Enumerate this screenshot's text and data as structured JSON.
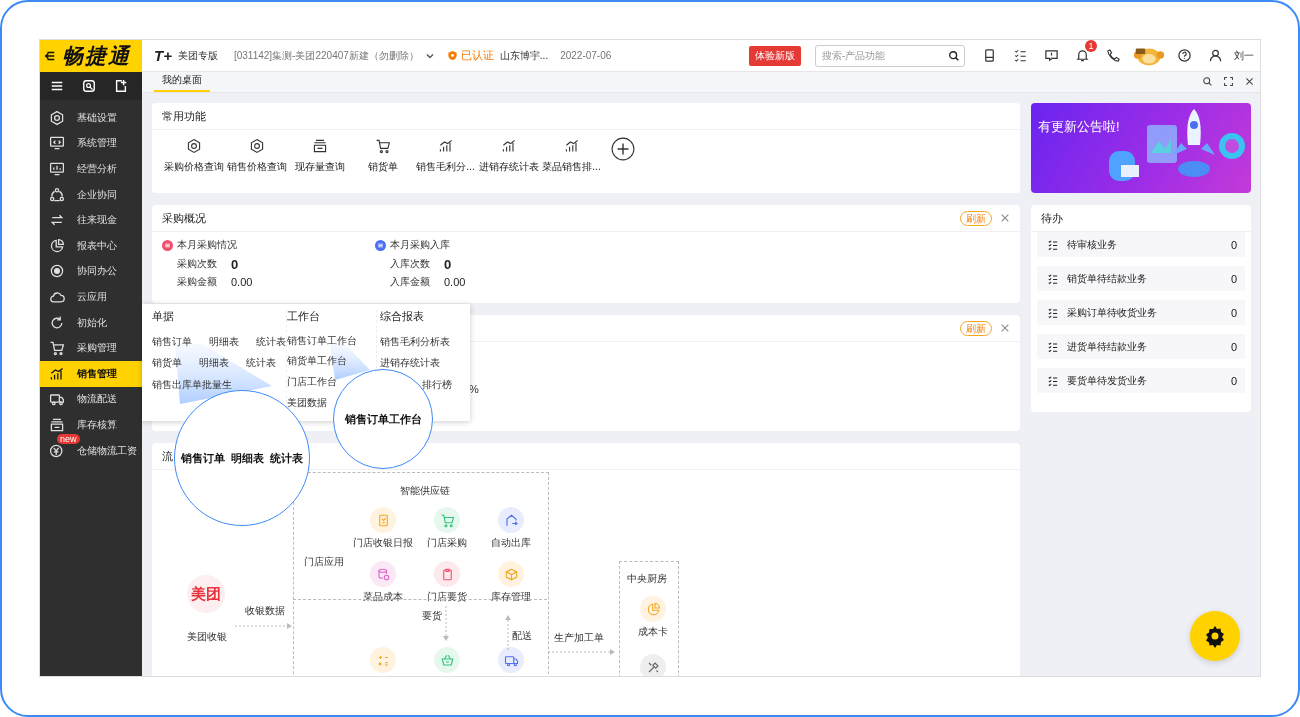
{
  "logo": {
    "text": "畅捷通"
  },
  "header": {
    "brand": "T+",
    "edition": "美团专版",
    "account": "[031142]集测-美团220407新建（勿删除）",
    "verified": "已认证",
    "company": "山东博宇...",
    "date": "2022-07-06",
    "try_new": "体验新版",
    "search": {
      "placeholder": "搜索-产品功能"
    },
    "notification_count": "1",
    "user": "刘一"
  },
  "tabs": [
    {
      "label": "我的桌面",
      "selected": true
    }
  ],
  "sidebar": {
    "items": [
      {
        "label": "基础设置",
        "selected": false
      },
      {
        "label": "系统管理",
        "selected": false
      },
      {
        "label": "经营分析",
        "selected": false
      },
      {
        "label": "企业协同",
        "selected": false
      },
      {
        "label": "往来现金",
        "selected": false
      },
      {
        "label": "报表中心",
        "selected": false
      },
      {
        "label": "协同办公",
        "selected": false
      },
      {
        "label": "云应用",
        "selected": false
      },
      {
        "label": "初始化",
        "selected": false
      },
      {
        "label": "采购管理",
        "selected": false
      },
      {
        "label": "销售管理",
        "selected": true
      },
      {
        "label": "物流配送",
        "selected": false
      },
      {
        "label": "库存核算",
        "selected": false
      },
      {
        "label": "仓储物流工资",
        "selected": false,
        "badge": "new"
      }
    ]
  },
  "common_functions": {
    "title": "常用功能",
    "items": [
      "采购价格查询",
      "销售价格查询",
      "现存量查询",
      "销货单",
      "销售毛利分...",
      "进销存统计表",
      "菜品销售排..."
    ]
  },
  "purchase_overview": {
    "title": "采购概况",
    "refresh": "刷新",
    "groups": [
      {
        "title": "本月采购情况",
        "color": "#f0506e",
        "rows": [
          {
            "label": "采购次数",
            "value": "0"
          },
          {
            "label": "采购金额",
            "value": "0.00"
          }
        ]
      },
      {
        "title": "本月采购入库",
        "color": "#4c6ef5",
        "rows": [
          {
            "label": "入库次数",
            "value": "0"
          },
          {
            "label": "入库金额",
            "value": "0.00"
          }
        ]
      }
    ]
  },
  "sales_card": {
    "refresh": "刷新",
    "value_fragment": "%"
  },
  "menu": {
    "columns": [
      {
        "title": "单据",
        "rows": [
          [
            "销售订单",
            "明细表",
            "统计表"
          ],
          [
            "销货单",
            "明细表",
            "统计表"
          ],
          [
            "销售出库单批量生"
          ]
        ]
      },
      {
        "title": "工作台",
        "rows": [
          [
            "销售订单工作台"
          ],
          [
            "销货单工作台"
          ],
          [
            "门店工作台"
          ],
          [
            "美团数据"
          ]
        ]
      },
      {
        "title": "综合报表",
        "rows": [
          [
            "销售毛利分析表"
          ],
          [
            "进销存统计表"
          ],
          [
            "排行榜"
          ]
        ]
      }
    ]
  },
  "lenses": [
    {
      "texts": [
        "销售订单",
        "明细表",
        "统计表"
      ]
    },
    {
      "texts": [
        "销售订单工作台"
      ]
    }
  ],
  "banner": {
    "text": "有更新公告啦!"
  },
  "todo": {
    "title": "待办",
    "items": [
      {
        "label": "待审核业务",
        "count": "0"
      },
      {
        "label": "销货单待结款业务",
        "count": "0"
      },
      {
        "label": "采购订单待收货业务",
        "count": "0"
      },
      {
        "label": "进货单待结款业务",
        "count": "0"
      },
      {
        "label": "要货单待发货业务",
        "count": "0"
      }
    ]
  },
  "flow": {
    "title": "流",
    "supply_chain": "智能供应链",
    "store_apps": "门店应用",
    "nodes": [
      "门店收银日报",
      "门店采购",
      "自动出库",
      "菜品成本",
      "门店要货",
      "库存管理"
    ],
    "meituan_logo": "美团",
    "meituan_label": "美团收银",
    "edges": [
      "收银数据",
      "要货",
      "配送",
      "生产加工单"
    ],
    "central_kitchen": "中央厨房",
    "kitchen_node": "成本卡"
  }
}
